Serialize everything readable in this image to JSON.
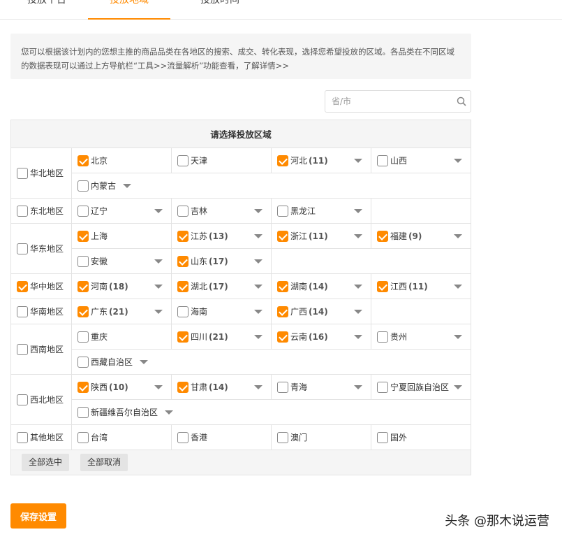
{
  "tabs": [
    {
      "label": "投放平台"
    },
    {
      "label": "投放地域"
    },
    {
      "label": "投放时间"
    }
  ],
  "notice": {
    "text": "您可以根据该计划内的您想主推的商品品类在各地区的搜索、成交、转化表现，选择您希望投放的区域。各品类在不同区域的数据表现可以通过上方导航栏“工具>>流量解析”功能查看，",
    "link": "了解详情>>"
  },
  "search": {
    "placeholder": "省/市"
  },
  "table_header": "请选择投放区域",
  "regions": [
    {
      "name": "华北地区",
      "checked": false,
      "rows": [
        [
          {
            "name": "北京",
            "checked": true,
            "count": "",
            "dropdown": false
          },
          {
            "name": "天津",
            "checked": false,
            "count": "",
            "dropdown": false
          },
          {
            "name": "河北",
            "checked": true,
            "count": "(11)",
            "dropdown": true
          },
          {
            "name": "山西",
            "checked": false,
            "count": "",
            "dropdown": true
          }
        ],
        [
          {
            "name": "内蒙古",
            "checked": false,
            "count": "",
            "dropdown": true
          }
        ]
      ]
    },
    {
      "name": "东北地区",
      "checked": false,
      "rows": [
        [
          {
            "name": "辽宁",
            "checked": false,
            "count": "",
            "dropdown": true
          },
          {
            "name": "吉林",
            "checked": false,
            "count": "",
            "dropdown": true
          },
          {
            "name": "黑龙江",
            "checked": false,
            "count": "",
            "dropdown": true
          }
        ]
      ]
    },
    {
      "name": "华东地区",
      "checked": false,
      "rows": [
        [
          {
            "name": "上海",
            "checked": true,
            "count": "",
            "dropdown": false
          },
          {
            "name": "江苏",
            "checked": true,
            "count": "(13)",
            "dropdown": true
          },
          {
            "name": "浙江",
            "checked": true,
            "count": "(11)",
            "dropdown": true
          },
          {
            "name": "福建",
            "checked": true,
            "count": "(9)",
            "dropdown": true
          }
        ],
        [
          {
            "name": "安徽",
            "checked": false,
            "count": "",
            "dropdown": true
          },
          {
            "name": "山东",
            "checked": true,
            "count": "(17)",
            "dropdown": true
          }
        ]
      ]
    },
    {
      "name": "华中地区",
      "checked": true,
      "rows": [
        [
          {
            "name": "河南",
            "checked": true,
            "count": "(18)",
            "dropdown": true
          },
          {
            "name": "湖北",
            "checked": true,
            "count": "(17)",
            "dropdown": true
          },
          {
            "name": "湖南",
            "checked": true,
            "count": "(14)",
            "dropdown": true
          },
          {
            "name": "江西",
            "checked": true,
            "count": "(11)",
            "dropdown": true
          }
        ]
      ]
    },
    {
      "name": "华南地区",
      "checked": false,
      "rows": [
        [
          {
            "name": "广东",
            "checked": true,
            "count": "(21)",
            "dropdown": true
          },
          {
            "name": "海南",
            "checked": false,
            "count": "",
            "dropdown": true
          },
          {
            "name": "广西",
            "checked": true,
            "count": "(14)",
            "dropdown": true
          }
        ]
      ]
    },
    {
      "name": "西南地区",
      "checked": false,
      "rows": [
        [
          {
            "name": "重庆",
            "checked": false,
            "count": "",
            "dropdown": false
          },
          {
            "name": "四川",
            "checked": true,
            "count": "(21)",
            "dropdown": true
          },
          {
            "name": "云南",
            "checked": true,
            "count": "(16)",
            "dropdown": true
          },
          {
            "name": "贵州",
            "checked": false,
            "count": "",
            "dropdown": true
          }
        ],
        [
          {
            "name": "西藏自治区",
            "checked": false,
            "count": "",
            "dropdown": true
          }
        ]
      ]
    },
    {
      "name": "西北地区",
      "checked": false,
      "rows": [
        [
          {
            "name": "陕西",
            "checked": true,
            "count": "(10)",
            "dropdown": true
          },
          {
            "name": "甘肃",
            "checked": true,
            "count": "(14)",
            "dropdown": true
          },
          {
            "name": "青海",
            "checked": false,
            "count": "",
            "dropdown": true
          },
          {
            "name": "宁夏回族自治区",
            "checked": false,
            "count": "",
            "dropdown": true
          }
        ],
        [
          {
            "name": "新疆维吾尔自治区",
            "checked": false,
            "count": "",
            "dropdown": true
          }
        ]
      ]
    },
    {
      "name": "其他地区",
      "checked": false,
      "rows": [
        [
          {
            "name": "台湾",
            "checked": false,
            "count": "",
            "dropdown": false
          },
          {
            "name": "香港",
            "checked": false,
            "count": "",
            "dropdown": false
          },
          {
            "name": "澳门",
            "checked": false,
            "count": "",
            "dropdown": false
          },
          {
            "name": "国外",
            "checked": false,
            "count": "",
            "dropdown": false
          }
        ]
      ]
    }
  ],
  "buttons": {
    "select_all": "全部选中",
    "deselect_all": "全部取消",
    "save": "保存设置"
  },
  "watermark": "头条 @那木说运营",
  "colors": {
    "accent": "#ff8a00",
    "panel": "#f5f5f5",
    "border": "#e3e3e3"
  }
}
